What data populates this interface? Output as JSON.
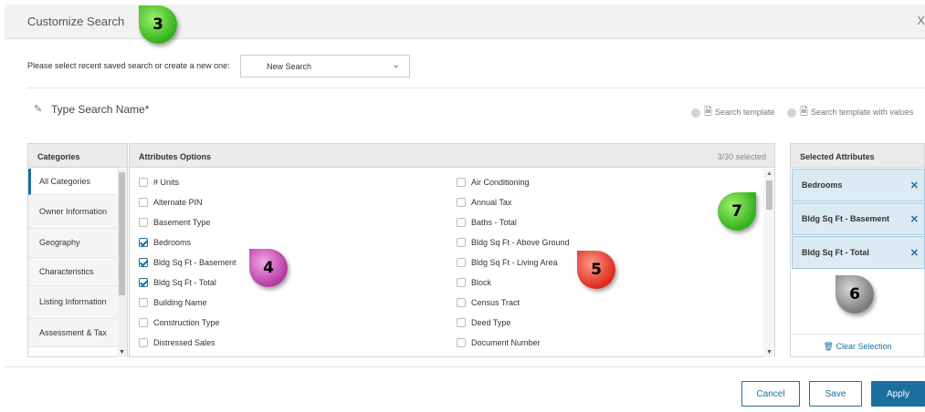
{
  "header": {
    "title": "Customize Search",
    "close_glyph": "X"
  },
  "markers": {
    "m3": "3",
    "m4": "4",
    "m5": "5",
    "m6": "6",
    "m7": "7"
  },
  "saved_search": {
    "label": "Please select recent saved search or create a new one:",
    "value": "New Search"
  },
  "search_name": {
    "label": "Type Search Name*"
  },
  "templates": {
    "option1": "Search template",
    "option2": "Search template with values"
  },
  "categories": {
    "header": "Categories",
    "items": [
      {
        "label": "All Categories"
      },
      {
        "label": "Owner Information"
      },
      {
        "label": "Geography"
      },
      {
        "label": "Characteristics"
      },
      {
        "label": "Listing Information"
      },
      {
        "label": "Assessment & Tax"
      }
    ]
  },
  "attributes": {
    "header": "Attributes Options",
    "count": "3/30 selected",
    "left": [
      {
        "label": "# Units",
        "checked": false
      },
      {
        "label": "Alternate PIN",
        "checked": false
      },
      {
        "label": "Basement Type",
        "checked": false
      },
      {
        "label": "Bedrooms",
        "checked": true
      },
      {
        "label": "Bldg Sq Ft - Basement",
        "checked": true
      },
      {
        "label": "Bldg Sq Ft - Total",
        "checked": true
      },
      {
        "label": "Building Name",
        "checked": false
      },
      {
        "label": "Construction Type",
        "checked": false
      },
      {
        "label": "Distressed Sales",
        "checked": false
      }
    ],
    "right": [
      {
        "label": "Air Conditioning",
        "checked": false
      },
      {
        "label": "Annual Tax",
        "checked": false
      },
      {
        "label": "Baths - Total",
        "checked": false
      },
      {
        "label": "Bldg Sq Ft - Above Ground",
        "checked": false
      },
      {
        "label": "Bldg Sq Ft - Living Area",
        "checked": false
      },
      {
        "label": "Block",
        "checked": false
      },
      {
        "label": "Census Tract",
        "checked": false
      },
      {
        "label": "Deed Type",
        "checked": false
      },
      {
        "label": "Document Number",
        "checked": false
      }
    ]
  },
  "selected": {
    "header": "Selected Attributes",
    "items": [
      {
        "label": "Bedrooms"
      },
      {
        "label": "Bldg Sq Ft - Basement"
      },
      {
        "label": "Bldg Sq Ft - Total"
      }
    ],
    "clear_label": "Clear Selection"
  },
  "footer": {
    "cancel": "Cancel",
    "save": "Save",
    "apply": "Apply"
  },
  "colors": {
    "accent": "#1b6f9e",
    "selected_bg": "#dceaf3"
  }
}
